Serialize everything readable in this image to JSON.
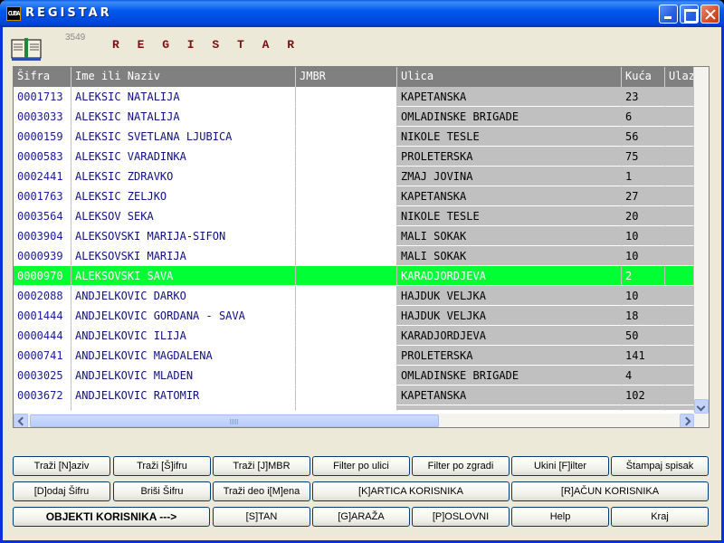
{
  "window": {
    "app_icon_text": "CUBA",
    "title": "REGISTAR"
  },
  "header": {
    "record_count": "3549",
    "title": "R E G I S T A R"
  },
  "grid": {
    "columns": [
      "Šifra",
      "Ime ili Naziv",
      "JMBR",
      "Ulica",
      "Kuća",
      "Ulaz"
    ],
    "rows": [
      {
        "sifra": "0001713",
        "naziv": "ALEKSIC NATALIJA",
        "jmbr": "",
        "ulica": "KAPETANSKA",
        "kuca": "23",
        "ulaz": ""
      },
      {
        "sifra": "0003033",
        "naziv": "ALEKSIC NATALIJA",
        "jmbr": "",
        "ulica": "OMLADINSKE BRIGADE",
        "kuca": "6",
        "ulaz": ""
      },
      {
        "sifra": "0000159",
        "naziv": "ALEKSIC SVETLANA LJUBICA",
        "jmbr": "",
        "ulica": "NIKOLE TESLE",
        "kuca": "56",
        "ulaz": ""
      },
      {
        "sifra": "0000583",
        "naziv": "ALEKSIC VARADINKA",
        "jmbr": "",
        "ulica": "PROLETERSKA",
        "kuca": "75",
        "ulaz": ""
      },
      {
        "sifra": "0002441",
        "naziv": "ALEKSIC ZDRAVKO",
        "jmbr": "",
        "ulica": "ZMAJ JOVINA",
        "kuca": "1",
        "ulaz": ""
      },
      {
        "sifra": "0001763",
        "naziv": "ALEKSIC ZELJKO",
        "jmbr": "",
        "ulica": "KAPETANSKA",
        "kuca": "27",
        "ulaz": ""
      },
      {
        "sifra": "0003564",
        "naziv": "ALEKSOV SEKA",
        "jmbr": "",
        "ulica": "NIKOLE TESLE",
        "kuca": "20",
        "ulaz": ""
      },
      {
        "sifra": "0003904",
        "naziv": "ALEKSOVSKI MARIJA-SIFON",
        "jmbr": "",
        "ulica": "MALI SOKAK",
        "kuca": "10",
        "ulaz": ""
      },
      {
        "sifra": "0000939",
        "naziv": "ALEKSOVSKI MARIJA",
        "jmbr": "",
        "ulica": "MALI SOKAK",
        "kuca": "10",
        "ulaz": ""
      },
      {
        "sifra": "0000970",
        "naziv": "ALEKSOVSKI SAVA",
        "jmbr": "",
        "ulica": "KARADJORDJEVA",
        "kuca": "2",
        "ulaz": ""
      },
      {
        "sifra": "0002088",
        "naziv": "ANDJELKOVIC DARKO",
        "jmbr": "",
        "ulica": "HAJDUK VELJKA",
        "kuca": "10",
        "ulaz": ""
      },
      {
        "sifra": "0001444",
        "naziv": "ANDJELKOVIC GORDANA - SAVA",
        "jmbr": "",
        "ulica": "HAJDUK VELJKA",
        "kuca": "18",
        "ulaz": ""
      },
      {
        "sifra": "0000444",
        "naziv": "ANDJELKOVIC ILIJA",
        "jmbr": "",
        "ulica": "KARADJORDJEVA",
        "kuca": "50",
        "ulaz": ""
      },
      {
        "sifra": "0000741",
        "naziv": "ANDJELKOVIC MAGDALENA",
        "jmbr": "",
        "ulica": "PROLETERSKA",
        "kuca": "141",
        "ulaz": ""
      },
      {
        "sifra": "0003025",
        "naziv": "ANDJELKOVIC MLADEN",
        "jmbr": "",
        "ulica": "OMLADINSKE BRIGADE",
        "kuca": "4",
        "ulaz": ""
      },
      {
        "sifra": "0003672",
        "naziv": "ANDJELKOVIC RATOMIR",
        "jmbr": "",
        "ulica": "KAPETANSKA",
        "kuca": "102",
        "ulaz": ""
      }
    ],
    "selected_index": 9,
    "selected_color": "#00ff33"
  },
  "buttons": {
    "row1": [
      "Traži [N]aziv",
      "Traži [Š]ifru",
      "Traži [J]MBR",
      "Filter po ulici",
      "Filter po zgradi",
      "Ukini [F]ilter",
      "Štampaj spisak"
    ],
    "row2": [
      "[D]odaj Šifru",
      "Briši Šifru",
      "Traži deo i[M]ena",
      "[K]ARTICA KORISNIKA",
      "[R]AČUN KORISNIKA"
    ],
    "row3": [
      "OBJEKTI KORISNIKA --->",
      "[S]TAN",
      "[G]ARAŽA",
      "[P]OSLOVNI",
      "Help",
      "Kraj"
    ]
  }
}
